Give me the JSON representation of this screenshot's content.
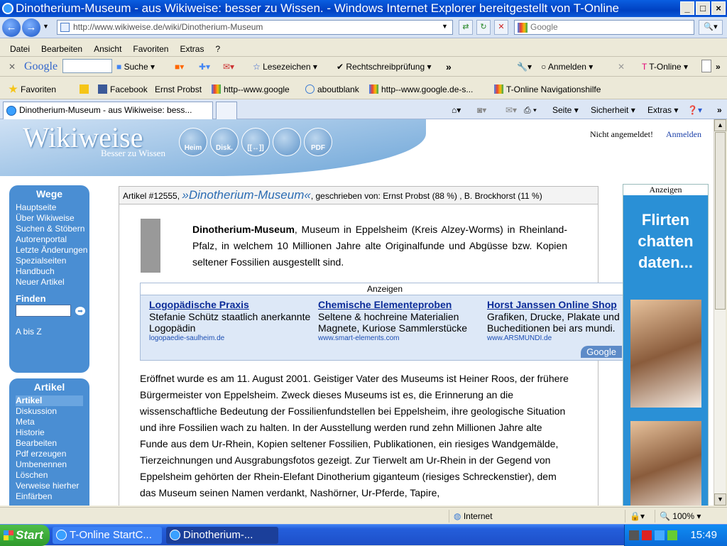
{
  "window": {
    "title": "Dinotherium-Museum - aus Wikiweise: besser zu Wissen. - Windows Internet Explorer bereitgestellt von T-Online"
  },
  "address": {
    "url": "http://www.wikiweise.de/wiki/Dinotherium-Museum",
    "search_placeholder": "Google"
  },
  "menu": [
    "Datei",
    "Bearbeiten",
    "Ansicht",
    "Favoriten",
    "Extras",
    "?"
  ],
  "toolbar": {
    "google": "Google",
    "suche": "Suche",
    "lesezeichen": "Lesezeichen",
    "rechtschreib": "Rechtschreibprüfung",
    "anmelden": "Anmelden",
    "tonline": "T-Online"
  },
  "favorites": {
    "label": "Favoriten",
    "items": [
      "Facebook",
      "Ernst Probst",
      "http--www.google",
      "aboutblank",
      "http--www.google.de-s...",
      "T-Online Navigationshilfe"
    ]
  },
  "tab": {
    "title": "Dinotherium-Museum - aus Wikiweise: bess..."
  },
  "commandbar": {
    "seite": "Seite",
    "sicherheit": "Sicherheit",
    "extras": "Extras"
  },
  "site": {
    "logo": "Wikiweise",
    "slogan": "Besser zu Wissen",
    "buttons": [
      "Heim",
      "Disk.",
      "[[↔]]",
      "",
      "PDF"
    ],
    "not_logged": "Nicht angemeldet!",
    "login": "Anmelden"
  },
  "sidebar": {
    "wege_title": "Wege",
    "wege": [
      "Hauptseite",
      "Über Wikiweise",
      "Suchen & Stöbern",
      "Autorenportal",
      "Letzte Änderungen",
      "Spezialseiten",
      "Handbuch",
      "Neuer Artikel"
    ],
    "finden": "Finden",
    "abisz": "A bis Z",
    "artikel_title": "Artikel",
    "artikel": [
      "Artikel",
      "Diskussion",
      "Meta",
      "Historie",
      "Bearbeiten",
      "Pdf erzeugen",
      "Umbenennen",
      "Löschen",
      "Verweise hierher",
      "Einfärben"
    ]
  },
  "article": {
    "number": "Artikel #12555,",
    "title": "»Dinotherium-Museum«",
    "authors": ", geschrieben von: Ernst Probst (88 %) , B. Brockhorst (11 %)",
    "intro_bold": "Dinotherium-Museum",
    "intro_rest": ", Museum in Eppelsheim (Kreis Alzey-Worms) in Rheinland-Pfalz, in welchem 10 Millionen Jahre alte Originalfunde und Abgüsse bzw. Kopien seltener Fossilien ausgestellt sind.",
    "paragraph": "Eröffnet wurde es am 11. August 2001. Geistiger Vater des Museums ist Heiner Roos, der frühere Bürgermeister von Eppelsheim. Zweck dieses Museums ist es, die Erinnerung an die wissenschaftliche Bedeutung der Fossilienfundstellen bei Eppelsheim, ihre geologische Situation und ihre Fossilien wach zu halten. In der Ausstellung werden rund zehn Millionen Jahre alte Funde aus dem Ur-Rhein, Kopien seltener Fossilien, Publikationen, ein riesiges Wandgemälde, Tierzeichnungen und Ausgrabungsfotos gezeigt. Zur Tierwelt am Ur-Rhein in der Gegend von Eppelsheim gehörten der Rhein-Elefant Dinotherium giganteum (riesiges Schreckenstier), dem das Museum seinen Namen verdankt, Nashörner, Ur-Pferde, Tapire,"
  },
  "ads": {
    "header": "Anzeigen",
    "items": [
      {
        "title": "Logopädische Praxis",
        "text": "Stefanie Schütz staatlich anerkannte Logopädin",
        "url": "logopaedie-saulheim.de"
      },
      {
        "title": "Chemische Elementeproben",
        "text": "Seltene & hochreine Materialien Magnete, Kuriose Sammlerstücke",
        "url": "www.smart-elements.com"
      },
      {
        "title": "Horst Janssen Online Shop",
        "text": "Grafiken, Drucke, Plakate und Bucheditionen bei ars mundi.",
        "url": "www.ARSMUNDI.de"
      }
    ],
    "google": "Google"
  },
  "right_ad": {
    "header": "Anzeigen",
    "text": "Flirten chatten daten..."
  },
  "status": {
    "zone": "Internet",
    "zoom": "100%"
  },
  "taskbar": {
    "start": "Start",
    "tasks": [
      "T-Online StartC...",
      "Dinotherium-..."
    ],
    "clock": "15:49"
  }
}
